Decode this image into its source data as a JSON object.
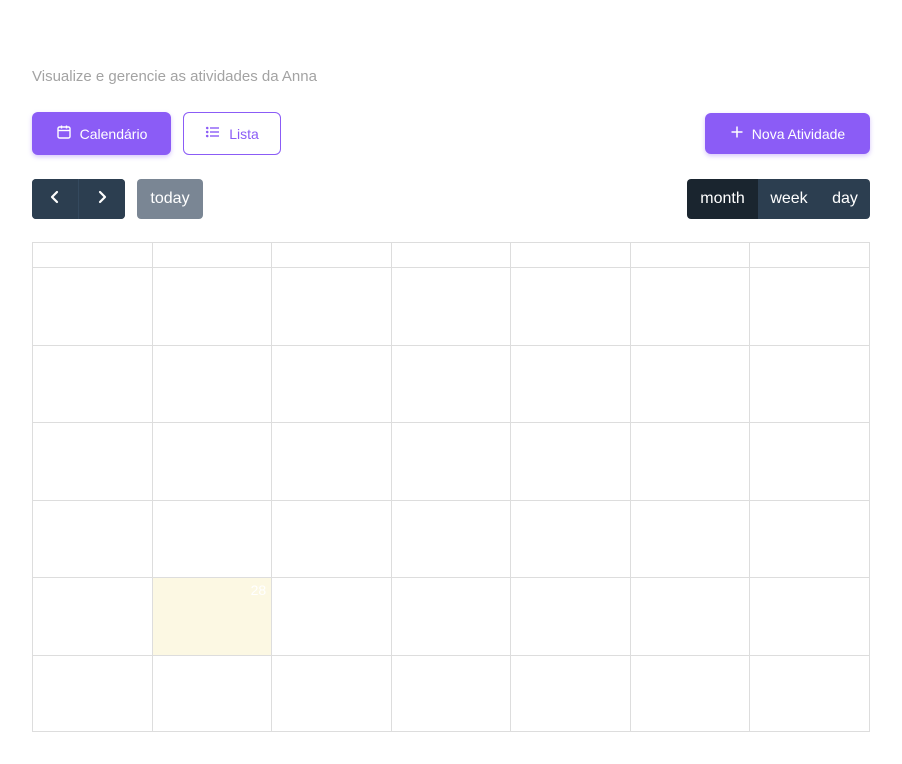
{
  "header": {
    "subtitle": "Visualize e gerencie as atividades da Anna"
  },
  "view_toggle": {
    "calendar_label": "Calendário",
    "list_label": "Lista"
  },
  "actions": {
    "new_activity_label": "Nova Atividade"
  },
  "toolbar": {
    "today_label": "today",
    "views": [
      "month",
      "week",
      "day"
    ],
    "active_view": "month"
  },
  "calendar": {
    "highlighted_day": "28"
  },
  "colors": {
    "accent": "#8b5cf6",
    "toolbar_dark": "#2c3e50",
    "today_bg": "#fcf8e3"
  }
}
